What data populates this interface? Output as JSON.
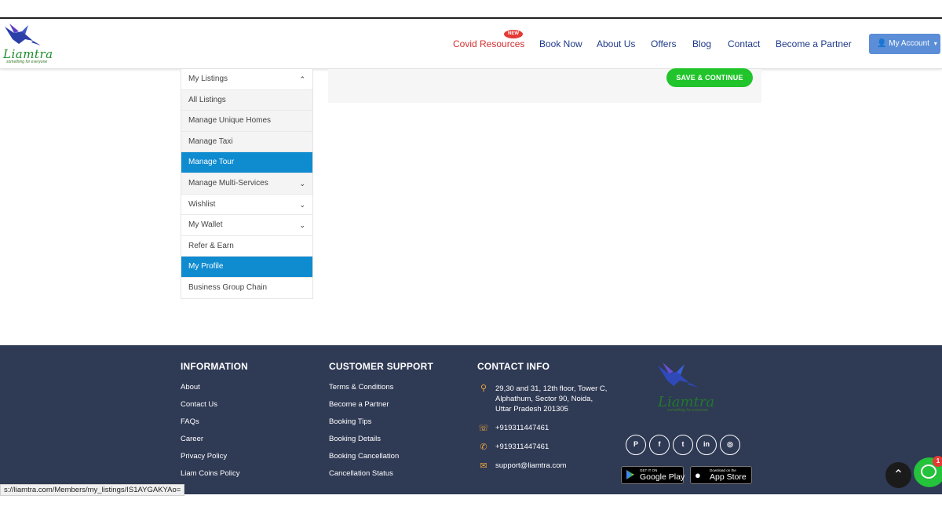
{
  "header": {
    "logo_text": "Liamtra",
    "logo_tagline": "something for everyone",
    "nav": [
      {
        "label": "Covid Resources"
      },
      {
        "label": "Book Now"
      },
      {
        "label": "About Us"
      },
      {
        "label": "Offers"
      },
      {
        "label": "Blog"
      },
      {
        "label": "Contact"
      },
      {
        "label": "Become a Partner"
      }
    ],
    "new_badge": "NEW",
    "account_label": "My Account"
  },
  "sidebar": {
    "items": [
      {
        "label": "My Listings",
        "caret": "⌃"
      },
      {
        "label": "All Listings"
      },
      {
        "label": "Manage Unique Homes"
      },
      {
        "label": "Manage Taxi"
      },
      {
        "label": "Manage Tour"
      },
      {
        "label": "Manage Multi-Services",
        "caret": "⌄"
      },
      {
        "label": "Wishlist",
        "caret": "⌄"
      },
      {
        "label": "My Wallet",
        "caret": "⌄"
      },
      {
        "label": "Refer & Earn"
      },
      {
        "label": "My Profile"
      },
      {
        "label": "Business Group Chain"
      }
    ]
  },
  "content": {
    "save_label": "SAVE & CONTINUE"
  },
  "footer": {
    "information": {
      "heading": "INFORMATION",
      "links": [
        "About",
        "Contact Us",
        "FAQs",
        "Career",
        "Privacy Policy",
        "Liam Coins Policy"
      ]
    },
    "support": {
      "heading": "CUSTOMER SUPPORT",
      "links": [
        "Terms & Conditions",
        "Become a Partner",
        "Booking Tips",
        "Booking Details",
        "Booking Cancellation",
        "Cancellation Status"
      ]
    },
    "contact": {
      "heading": "CONTACT INFO",
      "address_lines": [
        "29,30 and 31, 12th floor, Tower C,",
        "Alphathum, Sector 90, Noida,",
        "Uttar Pradesh 201305"
      ],
      "phone": "+919311447461",
      "whatsapp": "+919311447461",
      "email": "support@liamtra.com"
    },
    "logo_text": "Liamtra",
    "logo_tagline": "something for everyone",
    "social": [
      {
        "icon": "pinterest-icon",
        "glyph": "P"
      },
      {
        "icon": "facebook-icon",
        "glyph": "f"
      },
      {
        "icon": "twitter-icon",
        "glyph": "t"
      },
      {
        "icon": "linkedin-icon",
        "glyph": "in"
      },
      {
        "icon": "instagram-icon",
        "glyph": "◎"
      }
    ],
    "stores": {
      "google_small": "GET IT ON",
      "google_large": "Google Play",
      "apple_small": "Download on the",
      "apple_large": "App Store"
    }
  },
  "status_url": "s://liamtra.com/Members/my_listings/IS1AYGAKYAo=",
  "chat_badge": "1",
  "colors": {
    "footer_bg": "#2f3a55",
    "active_item": "#0f8bd0",
    "save_button": "#21c42a",
    "nav_link": "#1f3a8a",
    "covid_link": "#d32f2f",
    "account_button": "#5b8ed6"
  }
}
